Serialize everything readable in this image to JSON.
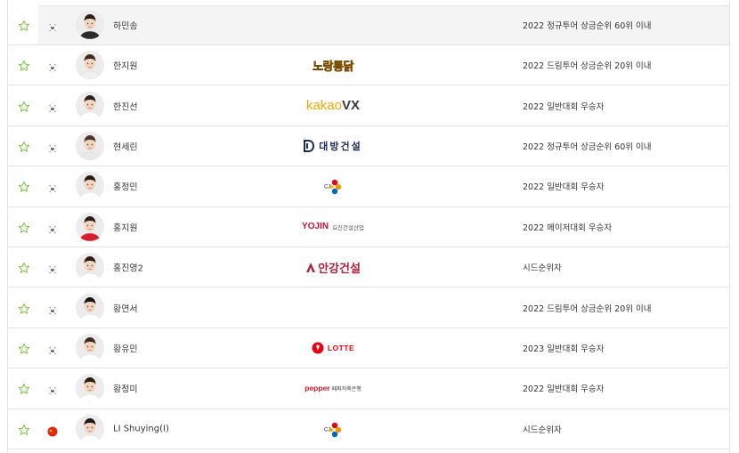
{
  "players": [
    {
      "name": "하민송",
      "country": "kr",
      "sponsor": "",
      "qualification": "2022 정규투어 상금순위 60위 이내"
    },
    {
      "name": "한지원",
      "country": "kr",
      "sponsor": "노랑통닭",
      "qualification": "2022 드림투어 상금순위 20위 이내"
    },
    {
      "name": "한진선",
      "country": "kr",
      "sponsor": "kakaoVX",
      "qualification": "2022 일반대회 우승자"
    },
    {
      "name": "현세린",
      "country": "kr",
      "sponsor": "대방건설",
      "qualification": "2022 정규투어 상금순위 60위 이내"
    },
    {
      "name": "홍정민",
      "country": "kr",
      "sponsor": "CJ",
      "qualification": "2022 일반대회 우승자"
    },
    {
      "name": "홍지원",
      "country": "kr",
      "sponsor": "YOJIN 요진건설산업",
      "qualification": "2022 메이저대회 우승자"
    },
    {
      "name": "홍진영2",
      "country": "kr",
      "sponsor": "안강건설",
      "qualification": "시드순위자"
    },
    {
      "name": "황연서",
      "country": "kr",
      "sponsor": "",
      "qualification": "2022 드림투어 상금순위 20위 이내"
    },
    {
      "name": "황유민",
      "country": "kr",
      "sponsor": "LOTTE",
      "qualification": "2023 일반대회 우승자"
    },
    {
      "name": "황정미",
      "country": "kr",
      "sponsor": "pepper 페퍼저축은행",
      "qualification": "2022 일반대회 우승자"
    },
    {
      "name": "LI Shuying(I)",
      "country": "cn",
      "sponsor": "CJ",
      "qualification": "시드순위자"
    }
  ],
  "sponsor_text": {
    "noranga": "노랑통닭",
    "kakao_a": "kakao",
    "kakao_b": "VX",
    "daebang": "대방건설",
    "cj": "CJ",
    "yojin_a": "YOJIN",
    "yojin_b": "요진건설산업",
    "angang": "안강건설",
    "lotte": "LOTTE",
    "pepper_a": "pepper",
    "pepper_b": "페퍼저축은행"
  },
  "colors": {
    "star": "#7bc142",
    "border": "#e3e3e3",
    "highlight": "#f4f4f4"
  }
}
